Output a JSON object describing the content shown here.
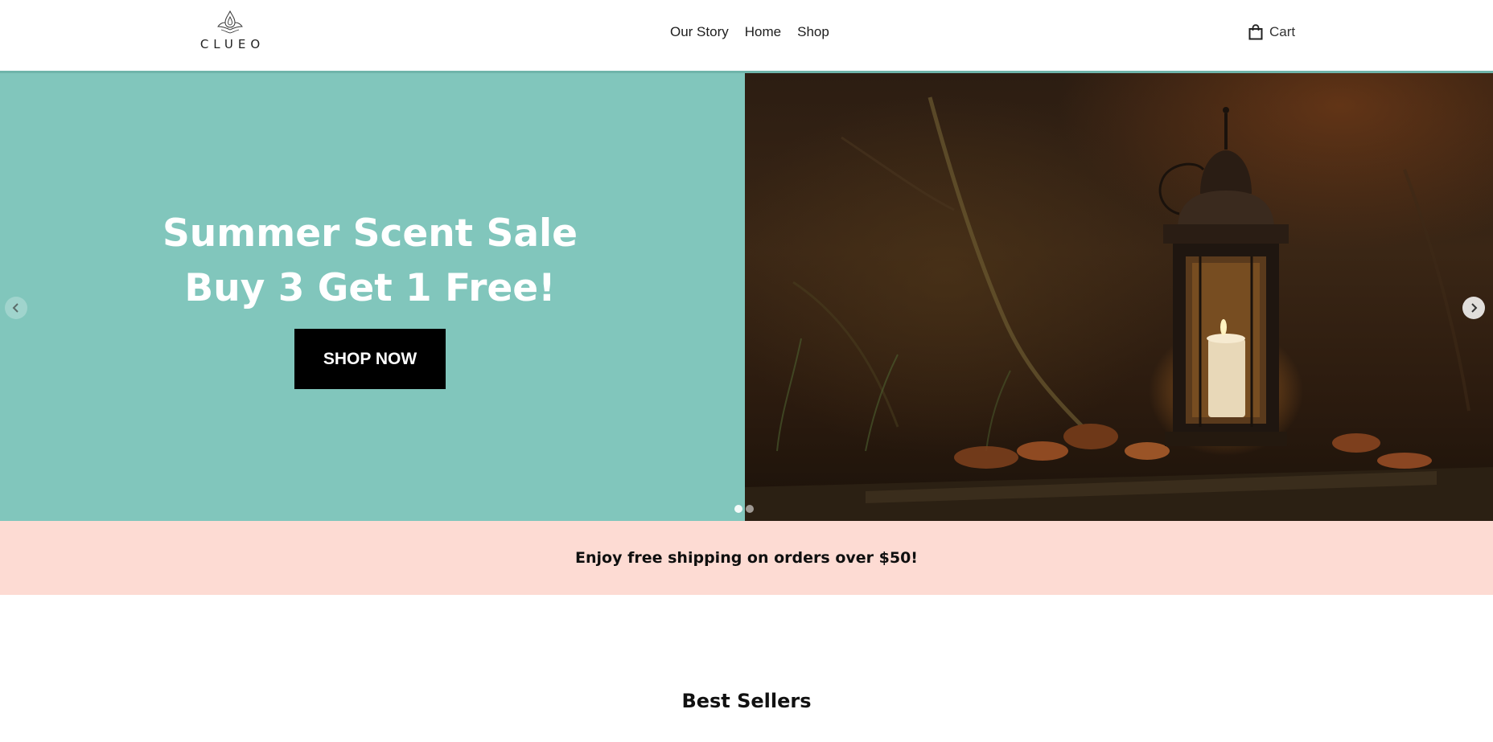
{
  "brand": {
    "name": "CLUEO"
  },
  "nav": {
    "items": [
      {
        "label": "Our Story"
      },
      {
        "label": "Home"
      },
      {
        "label": "Shop"
      }
    ]
  },
  "cart": {
    "label": "Cart",
    "icon": "shopping-bag-icon"
  },
  "hero": {
    "title_line1": "Summer Scent Sale",
    "title_line2": "Buy 3 Get 1 Free!",
    "cta_label": "SHOP NOW",
    "prev_icon": "chevron-left-icon",
    "next_icon": "chevron-right-icon",
    "slide_count": 2,
    "active_slide": 1,
    "left_panel_color": "#81c6bc"
  },
  "announcement": {
    "text": "Enjoy free shipping on orders over $50!",
    "background": "#fddbd3"
  },
  "best_sellers": {
    "heading": "Best Sellers"
  }
}
